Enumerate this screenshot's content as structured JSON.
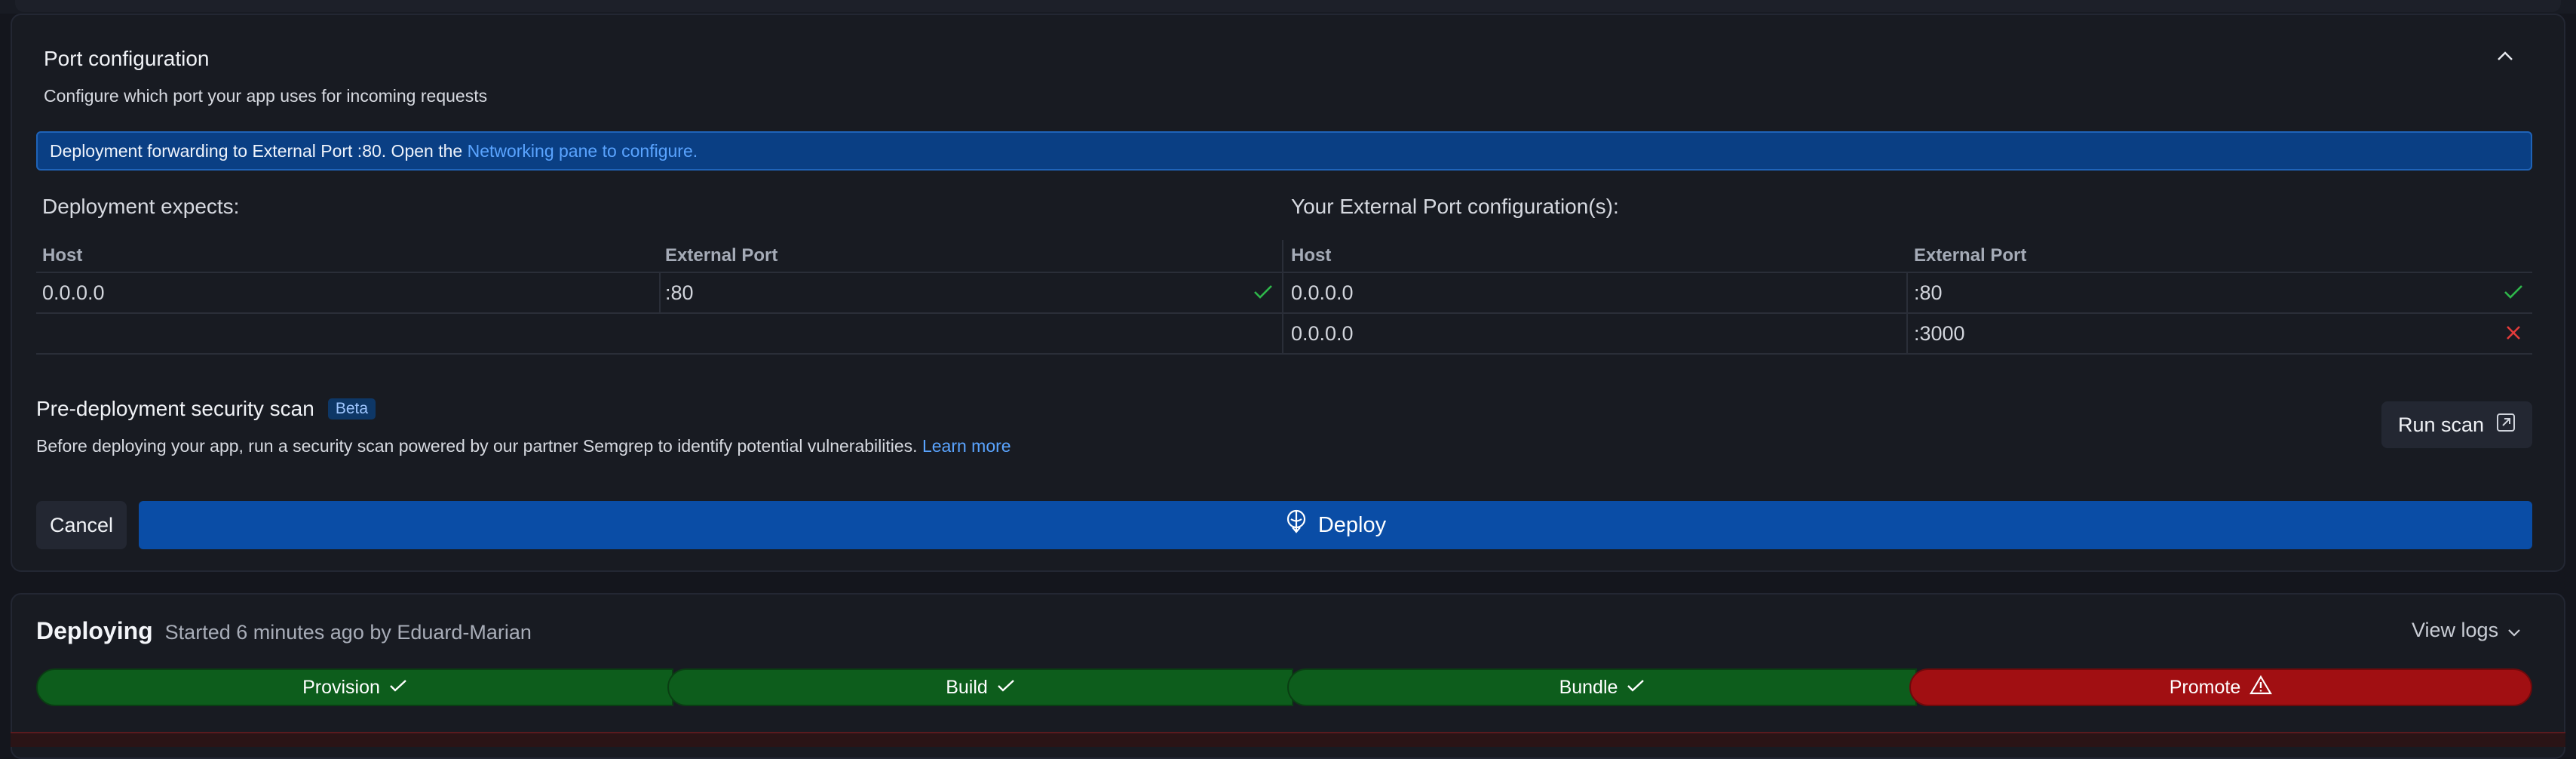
{
  "port_config": {
    "title": "Port configuration",
    "subtitle": "Configure which port your app uses for incoming requests",
    "banner_text": "Deployment forwarding to External Port :80. Open the",
    "banner_link": "Networking pane to configure.",
    "expects": {
      "heading": "Deployment expects:",
      "col_host": "Host",
      "col_port": "External Port",
      "rows": [
        {
          "host": "0.0.0.0",
          "port": ":80",
          "status": "ok"
        }
      ]
    },
    "external": {
      "heading": "Your External Port configuration(s):",
      "col_host": "Host",
      "col_port": "External Port",
      "rows": [
        {
          "host": "0.0.0.0",
          "port": ":80",
          "status": "ok"
        },
        {
          "host": "0.0.0.0",
          "port": ":3000",
          "status": "error"
        }
      ]
    }
  },
  "security_scan": {
    "title": "Pre-deployment security scan",
    "badge": "Beta",
    "description": "Before deploying your app, run a security scan powered by our partner Semgrep to identify potential vulnerabilities.",
    "learn_more": "Learn more",
    "run_scan_label": "Run scan"
  },
  "actions": {
    "cancel_label": "Cancel",
    "deploy_label": "Deploy"
  },
  "deployment": {
    "status": "Deploying",
    "meta": "Started 6 minutes ago by Eduard-Marian",
    "view_logs_label": "View logs",
    "stages": [
      {
        "label": "Provision",
        "state": "done"
      },
      {
        "label": "Build",
        "state": "done"
      },
      {
        "label": "Bundle",
        "state": "done"
      },
      {
        "label": "Promote",
        "state": "failed"
      }
    ]
  },
  "colors": {
    "accent_blue": "#0a4da6",
    "success_green": "#0d5d1c",
    "error_red": "#a10f12",
    "link_blue": "#5aa4ff"
  }
}
